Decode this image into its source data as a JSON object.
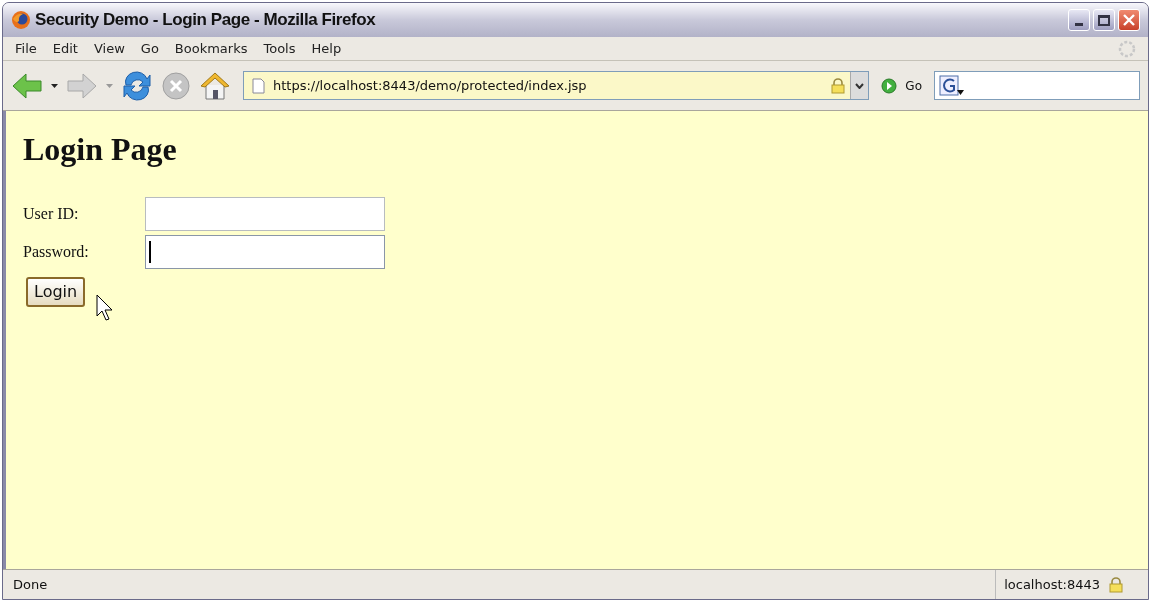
{
  "window": {
    "title": "Security Demo - Login Page - Mozilla Firefox"
  },
  "menu": [
    "File",
    "Edit",
    "View",
    "Go",
    "Bookmarks",
    "Tools",
    "Help"
  ],
  "toolbar": {
    "url": "https://localhost:8443/demo/protected/index.jsp",
    "go_label": "Go"
  },
  "page": {
    "heading": "Login Page",
    "fields": [
      {
        "label": "User ID:",
        "focused": false
      },
      {
        "label": "Password:",
        "focused": true
      }
    ],
    "button": "Login"
  },
  "status_bar": {
    "text": "Done",
    "host": "localhost:8443"
  }
}
